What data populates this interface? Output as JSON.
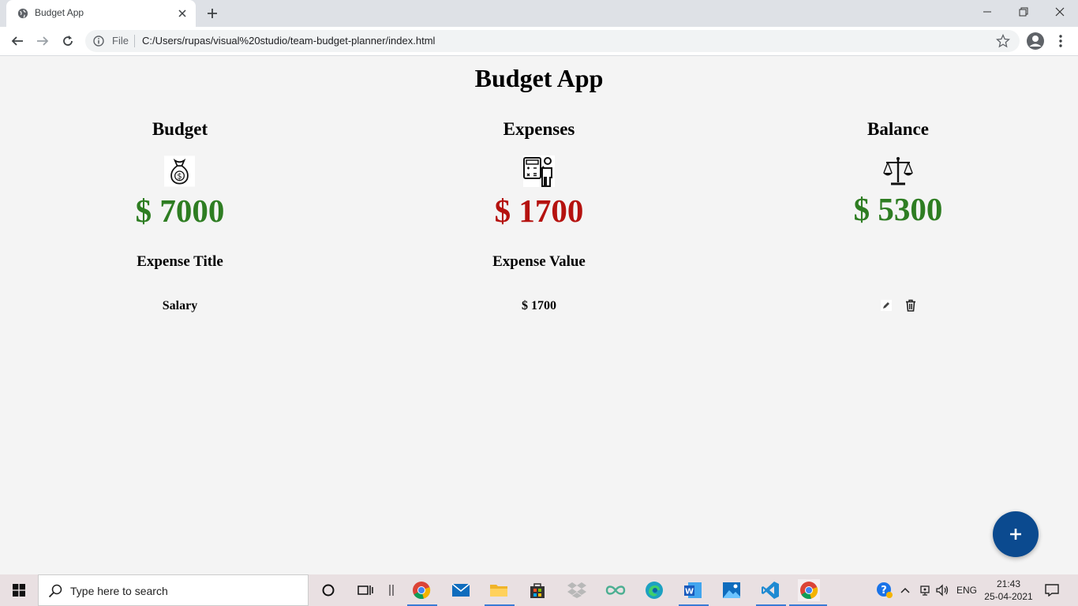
{
  "browser": {
    "tab_title": "Budget App",
    "omnibox": {
      "scheme_label": "File",
      "url": "C:/Users/rupas/visual%20studio/team-budget-planner/index.html"
    }
  },
  "app": {
    "title": "Budget App",
    "summary": {
      "budget": {
        "label": "Budget",
        "amount": "$ 7000",
        "icon": "money-bag-icon",
        "color": "#2e7d22"
      },
      "expenses": {
        "label": "Expenses",
        "amount": "$ 1700",
        "icon": "accountant-icon",
        "color": "#b5120f"
      },
      "balance": {
        "label": "Balance",
        "amount": "$ 5300",
        "icon": "scales-icon",
        "color": "#2e7d22"
      }
    },
    "table": {
      "headers": [
        "Expense Title",
        "Expense Value"
      ],
      "rows": [
        {
          "title": "Salary",
          "value": "$ 1700"
        }
      ]
    },
    "fab_label": "+"
  },
  "taskbar": {
    "search_placeholder": "Type here to search",
    "tray": {
      "language": "ENG",
      "time": "21:43",
      "date": "25-04-2021"
    }
  }
}
